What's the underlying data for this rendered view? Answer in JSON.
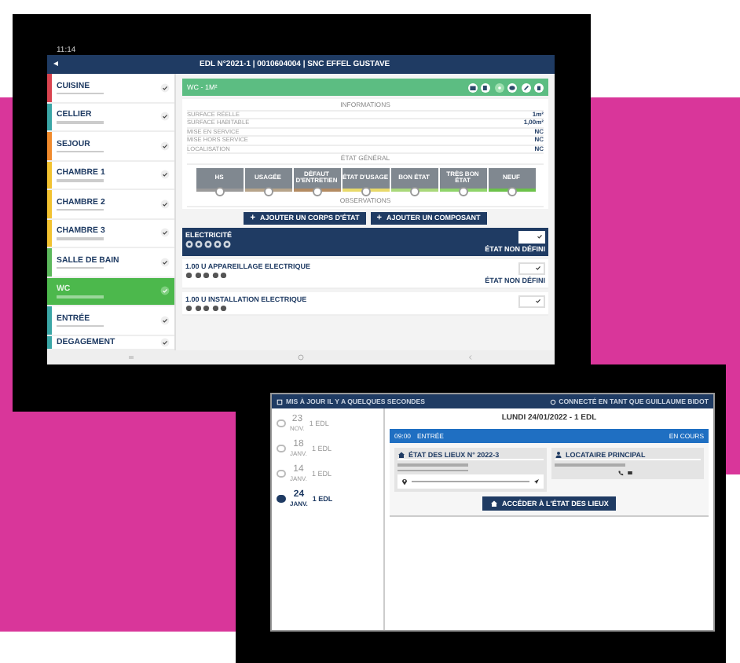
{
  "tablet": {
    "status_bar": {
      "time": "11:14"
    },
    "header": {
      "back": "◂",
      "title": "EDL N°2021-1 | 0010604004 | SNC EFFEL GUSTAVE"
    },
    "rooms": [
      {
        "name": "CUISINE",
        "color": "#d9434f",
        "selected": false,
        "checked": true
      },
      {
        "name": "CELLIER",
        "color": "#3aa6a6",
        "selected": false,
        "checked": true
      },
      {
        "name": "SEJOUR",
        "color": "#f08a2c",
        "selected": false,
        "checked": true
      },
      {
        "name": "CHAMBRE 1",
        "color": "#f2c230",
        "selected": false,
        "checked": true
      },
      {
        "name": "CHAMBRE 2",
        "color": "#f2c230",
        "selected": false,
        "checked": true
      },
      {
        "name": "CHAMBRE 3",
        "color": "#f2c230",
        "selected": false,
        "checked": true
      },
      {
        "name": "SALLE DE BAIN",
        "color": "#5cb85c",
        "selected": false,
        "checked": true
      },
      {
        "name": "WC",
        "selected": true,
        "checked": true
      },
      {
        "name": "ENTRÉE",
        "color": "#3aa6a6",
        "selected": false,
        "checked": true
      },
      {
        "name": "DEGAGEMENT",
        "color": "#3aa6a6",
        "selected": false,
        "checked": true
      }
    ],
    "room_header": {
      "title": "WC - 1M²"
    },
    "information": {
      "heading": "INFORMATIONS",
      "rows": [
        {
          "label": "SURFACE RÉELLE",
          "value": "1m²"
        },
        {
          "label": "SURFACE HABITABLE",
          "value": "1,00m²"
        },
        {
          "label": "MISE EN SERVICE",
          "value": "NC"
        },
        {
          "label": "MISE HORS SERVICE",
          "value": "NC"
        },
        {
          "label": "LOCALISATION",
          "value": "NC"
        }
      ]
    },
    "general_state": {
      "heading": "ÉTAT GÉNÉRAL",
      "options": [
        {
          "label": "HS",
          "color": "#9a9a9a",
          "selected": false
        },
        {
          "label": "USAGÉE",
          "color": "#b7a48a",
          "selected": false
        },
        {
          "label": "DÉFAUT D'ENTRETIEN",
          "color": "#b38b62",
          "selected": false
        },
        {
          "label": "ÉTAT D'USAGE",
          "color": "#e8d96a",
          "selected": false
        },
        {
          "label": "BON ÉTAT",
          "color": "#a9d87a",
          "selected": false
        },
        {
          "label": "TRÈS BON ÉTAT",
          "color": "#8fd46a",
          "selected": false
        },
        {
          "label": "NEUF",
          "color": "#6cc24a",
          "selected": false
        }
      ]
    },
    "observations": "OBSERVATIONS",
    "buttons": [
      {
        "icon": "+",
        "label": "AJOUTER UN CORPS D'ÉTAT"
      },
      {
        "icon": "+",
        "label": "AJOUTER UN COMPOSANT"
      }
    ],
    "trade": {
      "name": "ELECTRICITÉ",
      "checked": true,
      "state": "ÉTAT NON DÉFINI"
    },
    "components": [
      {
        "name": "1.00 U APPAREILLAGE ELECTRIQUE",
        "checked": true,
        "state": "ÉTAT NON DÉFINI"
      },
      {
        "name": "1.00 U INSTALLATION ELECTRIQUE",
        "checked": true
      }
    ]
  },
  "monitor": {
    "top_bar": {
      "updated": "MIS À JOUR IL Y A QUELQUES SECONDES",
      "user": "CONNECTÉ EN TANT QUE GUILLAUME BIDOT"
    },
    "days": [
      {
        "day": "23",
        "month": "NOV.",
        "count": "1 EDL",
        "selected": false
      },
      {
        "day": "18",
        "month": "JANV.",
        "count": "1 EDL",
        "selected": false
      },
      {
        "day": "14",
        "month": "JANV.",
        "count": "1 EDL",
        "selected": false
      },
      {
        "day": "24",
        "month": "JANV.",
        "count": "1 EDL",
        "selected": true
      }
    ],
    "date_title": "LUNDI 24/01/2022 - 1 EDL",
    "inspection": {
      "time": "09:00",
      "type": "ENTRÉE",
      "status": "EN COURS",
      "title": "ÉTAT DES LIEUX N° 2022-3"
    },
    "tenant": {
      "title": "LOCATAIRE PRINCIPAL"
    },
    "button": "ACCÉDER À L'ÉTAT DES LIEUX"
  }
}
